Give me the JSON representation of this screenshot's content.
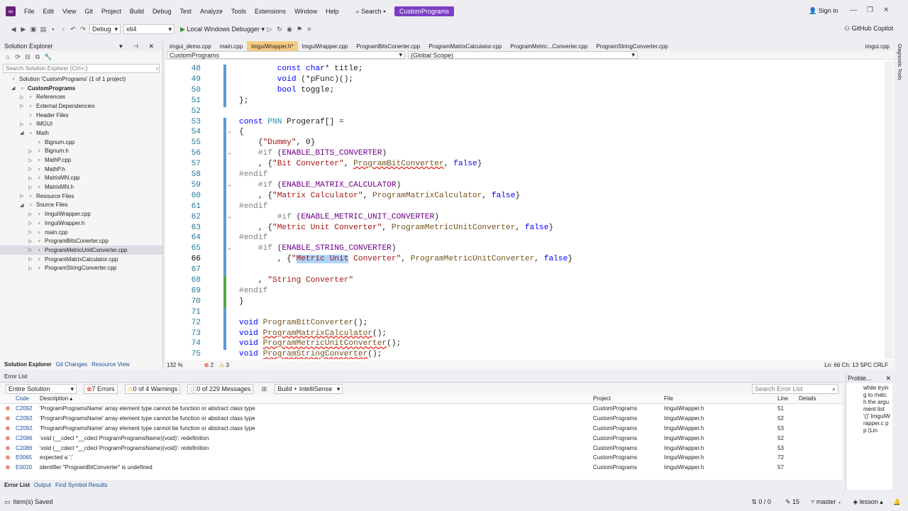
{
  "menu": [
    "File",
    "Edit",
    "View",
    "Git",
    "Project",
    "Build",
    "Debug",
    "Test",
    "Analyze",
    "Tools",
    "Extensions",
    "Window",
    "Help"
  ],
  "search_label": "Search",
  "solution_badge": "CustomPrograms",
  "sign_in": "Sign in",
  "toolbar": {
    "config": "Debug",
    "platform": "x64",
    "run": "Local Windows Debugger",
    "copilot": "GitHub Copilot"
  },
  "solution_explorer": {
    "title": "Solution Explorer",
    "search_placeholder": "Search Solution Explorer (Ctrl+;)",
    "items": [
      {
        "label": "Solution 'CustomPrograms' (1 of 1 project)",
        "indent": 0,
        "bold": false,
        "exp": ""
      },
      {
        "label": "CustomPrograms",
        "indent": 1,
        "bold": true,
        "exp": "◢"
      },
      {
        "label": "References",
        "indent": 2,
        "bold": false,
        "exp": "▷"
      },
      {
        "label": "External Dependencies",
        "indent": 2,
        "bold": false,
        "exp": "▷"
      },
      {
        "label": "Header Files",
        "indent": 2,
        "bold": false,
        "exp": ""
      },
      {
        "label": "IMGUI",
        "indent": 2,
        "bold": false,
        "exp": "▷"
      },
      {
        "label": "Math",
        "indent": 2,
        "bold": false,
        "exp": "◢"
      },
      {
        "label": "Bignum.cpp",
        "indent": 3,
        "bold": false,
        "exp": ""
      },
      {
        "label": "Bignum.h",
        "indent": 3,
        "bold": false,
        "exp": "▷"
      },
      {
        "label": "MathP.cpp",
        "indent": 3,
        "bold": false,
        "exp": "▷"
      },
      {
        "label": "MathP.h",
        "indent": 3,
        "bold": false,
        "exp": "▷"
      },
      {
        "label": "MatrixMN.cpp",
        "indent": 3,
        "bold": false,
        "exp": "▷"
      },
      {
        "label": "MatrixMN.h",
        "indent": 3,
        "bold": false,
        "exp": "▷"
      },
      {
        "label": "Resource Files",
        "indent": 2,
        "bold": false,
        "exp": "▷"
      },
      {
        "label": "Source Files",
        "indent": 2,
        "bold": false,
        "exp": "◢"
      },
      {
        "label": "ImguiWrapper.cpp",
        "indent": 3,
        "bold": false,
        "exp": "▷"
      },
      {
        "label": "ImguiWrapper.h",
        "indent": 3,
        "bold": false,
        "exp": "▷"
      },
      {
        "label": "main.cpp",
        "indent": 3,
        "bold": false,
        "exp": "▷"
      },
      {
        "label": "ProgramBitsConerter.cpp",
        "indent": 3,
        "bold": false,
        "exp": "▷"
      },
      {
        "label": "ProgramMetricUnitConverter.cpp",
        "indent": 3,
        "bold": false,
        "exp": "▷",
        "selected": true
      },
      {
        "label": "ProgramMatrixCalculator.cpp",
        "indent": 3,
        "bold": false,
        "exp": "▷"
      },
      {
        "label": "ProgramStringConverter.cpp",
        "indent": 3,
        "bold": false,
        "exp": "▷"
      }
    ],
    "tabs": [
      "Solution Explorer",
      "Git Changes",
      "Resource View"
    ]
  },
  "editor": {
    "tabs": [
      "imgui_demo.cpp",
      "main.cpp",
      "ImguiWrapper.h*",
      "ImguiWrapper.cpp",
      "ProgramBitsConerter.cpp",
      "ProgramMatrixCalculator.cpp",
      "ProgramMetric...Converter.cpp",
      "ProgramStringConverter.cpp",
      "imgui.cpp"
    ],
    "nav_project": "CustomPrograms",
    "nav_scope": "(Global Scope)",
    "zoom": "132 %",
    "errors": "2",
    "warnings": "3",
    "pos": "Ln: 66    Ch: 13    SPC    CRLF",
    "lines": [
      {
        "n": "48",
        "h": "        <span class='kw'>const</span> <span class='kw'>char</span>* title;"
      },
      {
        "n": "49",
        "h": "        <span class='kw'>void</span> (*pFunc)();"
      },
      {
        "n": "50",
        "h": "        <span class='kw'>bool</span> toggle;"
      },
      {
        "n": "51",
        "h": "};"
      },
      {
        "n": "52",
        "h": ""
      },
      {
        "n": "53",
        "h": "<span class='kw'>const</span> <span class='ty'>PNN</span> Progeraf[] ="
      },
      {
        "n": "54",
        "h": "{"
      },
      {
        "n": "55",
        "h": "    {<span class='str'>\"Dummy\"</span>, 0}"
      },
      {
        "n": "56",
        "h": "    <span class='pp'>#if</span> (<span class='mac'>ENABLE_BITS_CONVERTER</span>)"
      },
      {
        "n": "57",
        "h": "    , {<span class='str'>\"Bit Converter\"</span>, <span class='fn sq'>ProgramBitConverter</span>, <span class='kw'>false</span>}"
      },
      {
        "n": "58",
        "h": "<span class='pp'>#endif</span>"
      },
      {
        "n": "59",
        "h": "    <span class='pp'>#if</span> (<span class='mac'>ENABLE_MATRIX_CALCULATOR</span>)"
      },
      {
        "n": "60",
        "h": "    , {<span class='str'>\"Matrix Calculator\"</span>, <span class='fn'>ProgramMatrixCalculator</span>, <span class='kw'>false</span>}"
      },
      {
        "n": "61",
        "h": "<span class='pp'>#endif</span>"
      },
      {
        "n": "62",
        "h": "        <span class='pp'>#if</span> (<span class='mac'>ENABLE_METRIC_UNIT_CONVERTER</span>)"
      },
      {
        "n": "63",
        "h": "    , {<span class='str'>\"Metric Unit Converter\"</span>, <span class='fn'>ProgramMetricUnitConverter</span>, <span class='kw'>false</span>}"
      },
      {
        "n": "64",
        "h": "<span class='pp'>#endif</span>"
      },
      {
        "n": "65",
        "h": "    <span class='pp'>#if</span> (<span class='mac'>ENABLE_STRING_CONVERTER</span>)"
      },
      {
        "n": "66",
        "h": "        , {<span class='str'>\"<span class='hl'>Metric Unit</span> Converter\"</span>, <span class='fn'>ProgramMetricUnitConverter</span>, <span class='kw'>false</span>}",
        "cur": true
      },
      {
        "n": "67",
        "h": ""
      },
      {
        "n": "68",
        "h": "    , <span class='str'>\"String Converter\"</span>"
      },
      {
        "n": "69",
        "h": "<span class='pp'>#endif</span>"
      },
      {
        "n": "70",
        "h": "}"
      },
      {
        "n": "71",
        "h": ""
      },
      {
        "n": "72",
        "h": "<span class='kw'>void</span> <span class='fn'>ProgramBitConverter</span>();"
      },
      {
        "n": "73",
        "h": "<span class='kw'>void</span> <span class='fn sq'>ProgramMatrixCalculator</span>();"
      },
      {
        "n": "74",
        "h": "<span class='kw'>void</span> <span class='fn sq'>ProgramMetricUnitConverter</span>();"
      },
      {
        "n": "75",
        "h": "<span class='kw'>void</span> <span class='fn sq'>ProgramStringConverter</span>();"
      }
    ]
  },
  "error_list": {
    "title": "Error List",
    "scope": "Entire Solution",
    "errors_btn": "7 Errors",
    "warnings_btn": "0 of 4 Warnings",
    "messages_btn": "0 of 229 Messages",
    "build_filter": "Build + IntelliSense",
    "search_placeholder": "Search Error List",
    "headers": {
      "code": "Code",
      "desc": "Description",
      "project": "Project",
      "file": "File",
      "line": "Line",
      "details": "Details"
    },
    "rows": [
      {
        "icon": "error",
        "code": "C2092",
        "desc": "'ProgramProgramsName' array element type cannot be function or abstract class type",
        "project": "CustomPrograms",
        "file": "ImguiWrapper.h",
        "line": "51"
      },
      {
        "icon": "error",
        "code": "C2092",
        "desc": "'ProgramProgramsName' array element type cannot be function or abstract class type",
        "project": "CustomPrograms",
        "file": "ImguiWrapper.h",
        "line": "52"
      },
      {
        "icon": "error",
        "code": "C2092",
        "desc": "'ProgramProgramsName' array element type cannot be function or abstract class type",
        "project": "CustomPrograms",
        "file": "ImguiWrapper.h",
        "line": "53"
      },
      {
        "icon": "error",
        "code": "C2086",
        "desc": "'void (__cdecl *__cdecl ProgramProgramsName)(void)': redefinition",
        "project": "CustomPrograms",
        "file": "ImguiWrapper.h",
        "line": "52"
      },
      {
        "icon": "error",
        "code": "C2086",
        "desc": "'void (__cdecl *__cdecl ProgramProgramsName)(void)': redefinition",
        "project": "CustomPrograms",
        "file": "ImguiWrapper.h",
        "line": "53"
      },
      {
        "icon": "error",
        "code": "E0065",
        "desc": "expected a ';'",
        "project": "CustomPrograms",
        "file": "ImguiWrapper.h",
        "line": "72"
      },
      {
        "icon": "error",
        "code": "E0020",
        "desc": "identifier \"ProgramBitConverter\" is undefined",
        "project": "CustomPrograms",
        "file": "ImguiWrapper.h",
        "line": "57"
      }
    ],
    "tabs": [
      "Error List",
      "Output",
      "Find Symbol Results"
    ]
  },
  "problems": {
    "title": "Proble...",
    "text": "while tryin g to matc h the argu ment list '()' ImguiWrapper.c pp (Lin"
  },
  "status": {
    "left": "Item(s) Saved",
    "updown": "0 / 0",
    "pen": "15",
    "branch": "master",
    "repo": "lesson"
  },
  "colors": {
    "accent": "#68217a",
    "error": "#e51400",
    "tab_active": "#f5cc84"
  }
}
